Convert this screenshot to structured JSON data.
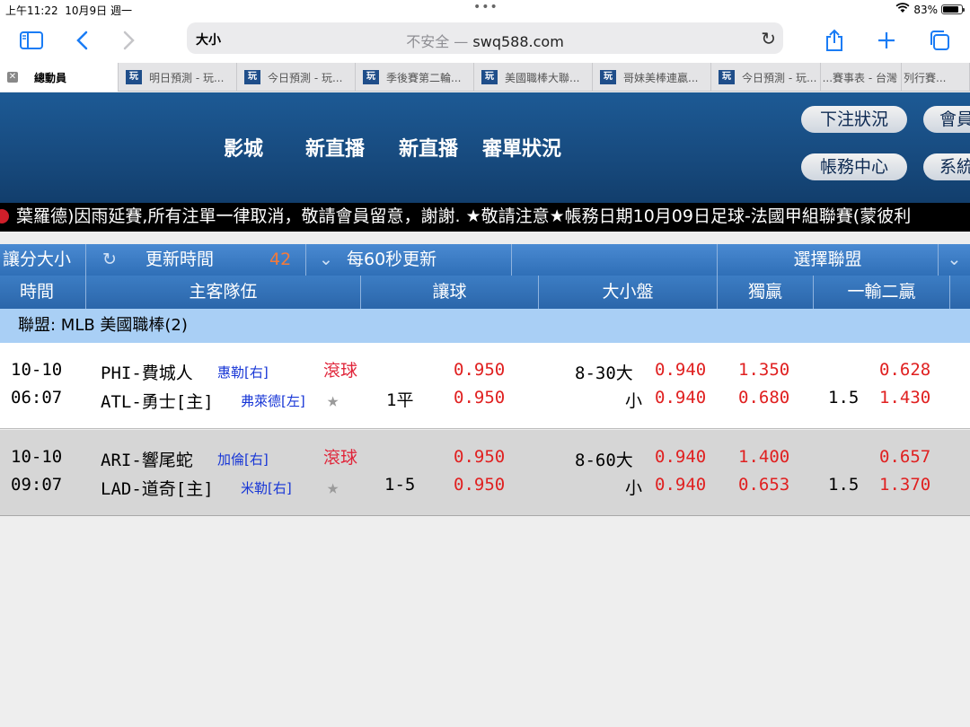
{
  "status_bar": {
    "time": "上午11:22",
    "date": "10月9日 週一",
    "battery": "83%",
    "battery_level": 0.83
  },
  "browser": {
    "text_size_label": "大小",
    "not_secure": "不安全 —",
    "domain": "swq588.com",
    "icons": [
      "sidebar-icon",
      "back-icon",
      "forward-icon",
      "reload-icon",
      "share-icon",
      "new-tab-icon",
      "tabs-icon"
    ]
  },
  "tabs": [
    {
      "label": "總動員",
      "active": true
    },
    {
      "label": "明日預測 - 玩..."
    },
    {
      "label": "今日預測 - 玩..."
    },
    {
      "label": "季後賽第二輪..."
    },
    {
      "label": "美國職棒大聯..."
    },
    {
      "label": "哥妹美棒連贏..."
    },
    {
      "label": "今日預測 - 玩..."
    },
    {
      "label": "賽事表 - 台灣..."
    },
    {
      "label": "列行賽..."
    }
  ],
  "tab_favicon": "玩",
  "site": {
    "nav": [
      "影城",
      "新直播",
      "新直播",
      "審單狀況"
    ],
    "buttons": [
      "下注狀況",
      "會員",
      "帳務中心",
      "系統"
    ],
    "marquee": "葉羅德)因雨延賽,所有注單一律取消，敬請會員留意，謝謝. ★敬請注意★帳務日期10月09日足球-法國甲組聯賽(蒙彼利"
  },
  "controls": {
    "bet_type": "讓分大小",
    "update_label": "更新時間",
    "countdown": "42",
    "interval": "每60秒更新",
    "league_select": "選擇聯盟"
  },
  "columns": [
    "時間",
    "主客隊伍",
    "讓球",
    "大小盤",
    "獨贏",
    "一輸二贏"
  ],
  "league": "聯盟: MLB 美國職棒(2)",
  "matches": [
    {
      "date": "10-10",
      "time": "06:07",
      "away_team": "PHI-費城人",
      "home_team": "ATL-勇士[主]",
      "away_pitcher": "惠勒[右]",
      "home_pitcher": "弗萊德[左]",
      "live": "滾球",
      "handicap": "1平",
      "handicap_odds_1": "0.950",
      "handicap_odds_2": "0.950",
      "total_line": "8-30大",
      "under_label": "小",
      "over_odds": "0.940",
      "under_odds": "0.940",
      "ml_1": "1.350",
      "ml_2": "0.680",
      "rl_line": "1.5",
      "rl_1": "0.628",
      "rl_2": "1.430"
    },
    {
      "date": "10-10",
      "time": "09:07",
      "away_team": "ARI-響尾蛇",
      "home_team": "LAD-道奇[主]",
      "away_pitcher": "加倫[右]",
      "home_pitcher": "米勒[右]",
      "live": "滾球",
      "handicap": "1-5",
      "handicap_odds_1": "0.950",
      "handicap_odds_2": "0.950",
      "total_line": "8-60大",
      "under_label": "小",
      "over_odds": "0.940",
      "under_odds": "0.940",
      "ml_1": "1.400",
      "ml_2": "0.653",
      "rl_line": "1.5",
      "rl_1": "0.657",
      "rl_2": "1.370"
    }
  ]
}
